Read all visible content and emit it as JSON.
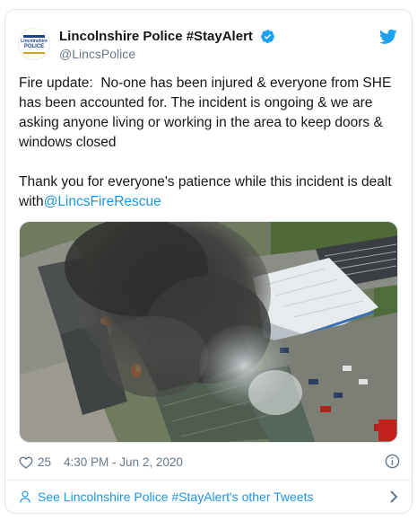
{
  "tweet": {
    "author": {
      "display_name": "Lincolnshire Police #StayAlert",
      "handle": "@LincsPolice",
      "verified": true,
      "avatar_lines": [
        "Lincolnshire",
        "POLICE"
      ]
    },
    "text_main": "Fire update:  No-one has been injured & everyone from SHE has been accounted for. The incident is ongoing & we are asking anyone living or working in the area to keep doors & windows closed\n\nThank you for everyone's patience while this incident is dealt with",
    "mention": "@LincsFireRescue",
    "likes": "25",
    "timestamp": "4:30 PM - Jun 2, 2020",
    "see_more": "See Lincolnshire Police #StayAlert's other Tweets"
  },
  "icons": {
    "logo": "twitter-bird-icon",
    "verified": "verified-badge-icon",
    "like": "heart-icon",
    "info": "info-icon",
    "person": "person-icon",
    "chevron": "chevron-right-icon"
  },
  "colors": {
    "link": "#1b95e0",
    "text": "#14171a",
    "muted": "#657786",
    "border": "#dfe3e7"
  }
}
